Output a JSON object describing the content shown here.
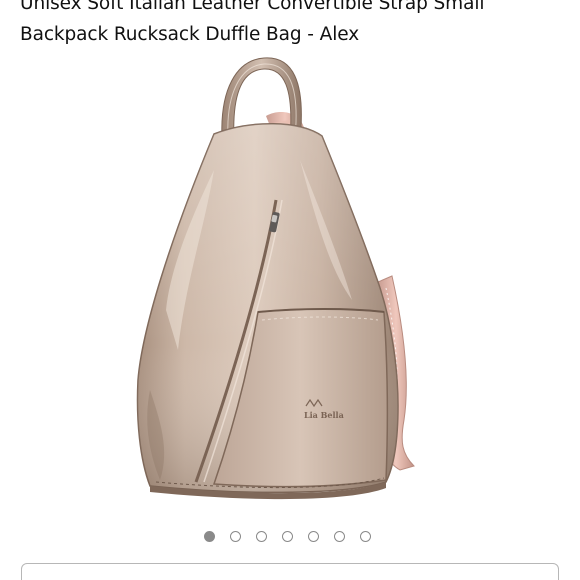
{
  "product": {
    "title": "Unisex Soft Italian Leather Convertible Strap Small Backpack Rucksack Duffle Bag - Alex",
    "image": {
      "description_icon": "backpack-image",
      "logo_text": "Lia Bella",
      "colors": {
        "leather": "#c9b4a4",
        "leather_light": "#e9ddd2",
        "leather_dark": "#8e7767",
        "strap_pink": "#e6b4a8"
      }
    }
  },
  "carousel": {
    "total": 7,
    "active_index": 0,
    "dot_color": "#8a8a8a"
  }
}
